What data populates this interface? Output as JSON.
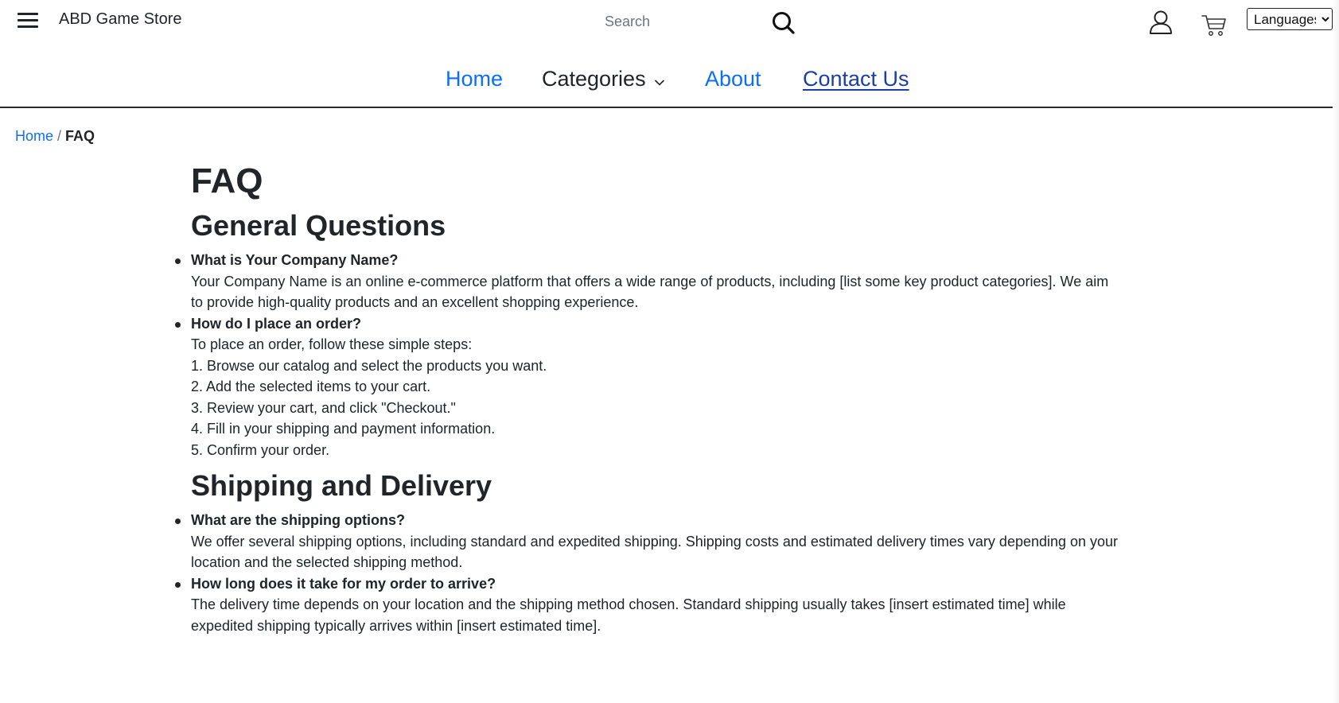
{
  "header": {
    "brand": "ABD Game Store",
    "search_placeholder": "Search",
    "language_select": {
      "selected": "Languages",
      "options": [
        "Languages"
      ]
    }
  },
  "nav": {
    "home": "Home",
    "categories": "Categories",
    "about": "About",
    "contact": "Contact Us"
  },
  "breadcrumb": {
    "home": "Home",
    "separator": "/",
    "current": "FAQ"
  },
  "page": {
    "title": "FAQ",
    "sections": [
      {
        "title": "General Questions",
        "items": [
          {
            "question": "What is Your Company Name?",
            "answer": [
              "Your Company Name is an online e-commerce platform that offers a wide range of products, including [list some key product categories]. We aim to provide high-quality products and an excellent shopping experience."
            ]
          },
          {
            "question": "How do I place an order?",
            "answer": [
              "To place an order, follow these simple steps:",
              "1. Browse our catalog and select the products you want.",
              "2. Add the selected items to your cart.",
              "3. Review your cart, and click \"Checkout.\"",
              "4. Fill in your shipping and payment information.",
              "5. Confirm your order."
            ]
          }
        ]
      },
      {
        "title": "Shipping and Delivery",
        "items": [
          {
            "question": "What are the shipping options?",
            "answer": [
              "We offer several shipping options, including standard and expedited shipping. Shipping costs and estimated delivery times vary depending on your location and the selected shipping method."
            ]
          },
          {
            "question": "How long does it take for my order to arrive?",
            "answer": [
              "The delivery time depends on your location and the shipping method chosen. Standard shipping usually takes [insert estimated time] while expedited shipping typically arrives within [insert estimated time]."
            ]
          }
        ]
      }
    ]
  },
  "icons": {
    "menu": "hamburger-menu-icon",
    "search": "search-icon",
    "user": "user-icon",
    "cart": "cart-icon",
    "dropdown": "chevron-down-icon"
  },
  "colors": {
    "link": "#0d6efd",
    "text": "#212529",
    "contact_link": "#1a3fa8"
  }
}
